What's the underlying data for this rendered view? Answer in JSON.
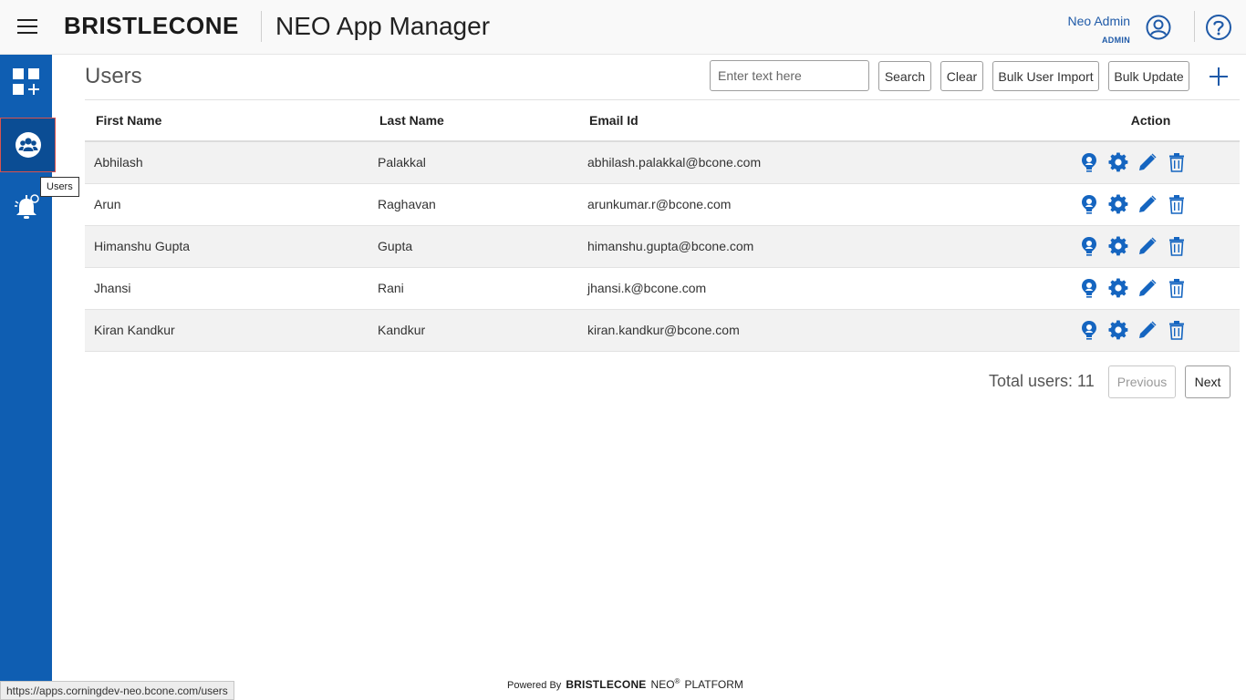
{
  "header": {
    "brand": "BRISTLECONE",
    "app_title": "NEO App Manager",
    "user_name": "Neo Admin",
    "user_role": "ADMIN"
  },
  "sidebar": {
    "items": [
      {
        "name": "apps",
        "icon": "apps-grid-add-icon"
      },
      {
        "name": "users",
        "icon": "users-group-icon",
        "active": true
      },
      {
        "name": "notifications",
        "icon": "bell-settings-icon"
      }
    ],
    "tooltip": "Users"
  },
  "page": {
    "title": "Users",
    "search_placeholder": "Enter text here",
    "search_label": "Search",
    "clear_label": "Clear",
    "bulk_import_label": "Bulk User Import",
    "bulk_update_label": "Bulk Update"
  },
  "table": {
    "columns": [
      "First Name",
      "Last Name",
      "Email Id",
      "Action"
    ],
    "rows": [
      {
        "first": "Abhilash",
        "last": "Palakkal",
        "email": "abhilash.palakkal@bcone.com"
      },
      {
        "first": "Arun",
        "last": "Raghavan",
        "email": "arunkumar.r@bcone.com"
      },
      {
        "first": "Himanshu Gupta",
        "last": "Gupta",
        "email": "himanshu.gupta@bcone.com"
      },
      {
        "first": "Jhansi",
        "last": "Rani",
        "email": "jhansi.k@bcone.com"
      },
      {
        "first": "Kiran Kandkur",
        "last": "Kandkur",
        "email": "kiran.kandkur@bcone.com"
      }
    ],
    "action_icons": [
      "role-icon",
      "settings-icon",
      "edit-icon",
      "delete-icon"
    ]
  },
  "pagination": {
    "total_label": "Total users: 11",
    "previous_label": "Previous",
    "next_label": "Next"
  },
  "footer": {
    "powered_by": "Powered By",
    "brand": "BRISTLECONE",
    "neo": "NEO",
    "registered": "®",
    "platform": "PLATFORM"
  },
  "status_url": "https://apps.corningdev-neo.bcone.com/users",
  "colors": {
    "sidebar": "#0f5eb2",
    "accent": "#1f5aa8",
    "icon_blue": "#1565c0"
  }
}
